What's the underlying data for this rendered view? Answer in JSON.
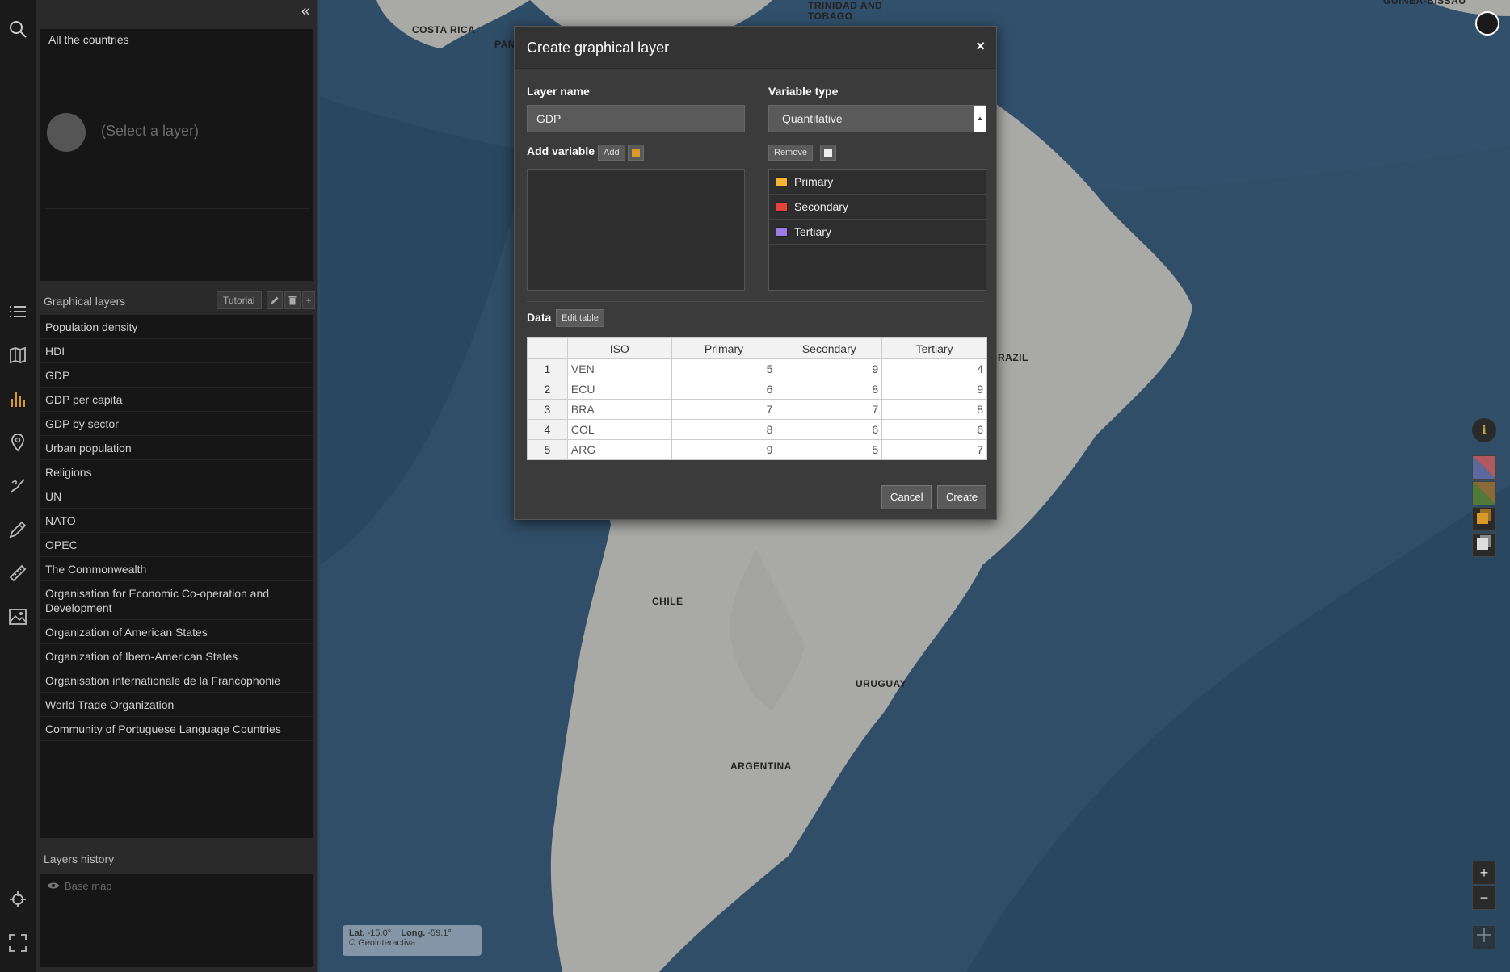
{
  "sidebar": {
    "collapse_icon": "«",
    "tools": [
      {
        "name": "search-icon"
      },
      {
        "name": "list-icon"
      },
      {
        "name": "map-book-icon"
      },
      {
        "name": "bar-chart-icon"
      },
      {
        "name": "location-pin-icon"
      },
      {
        "name": "draw-icon"
      },
      {
        "name": "pencil-icon"
      },
      {
        "name": "ruler-icon"
      },
      {
        "name": "image-icon"
      },
      {
        "name": "crosshair-icon"
      },
      {
        "name": "fullscreen-icon"
      }
    ]
  },
  "countries": {
    "title": "All the countries",
    "placeholder": "(Select a layer)"
  },
  "graphical_layers": {
    "title": "Graphical layers",
    "tutorial_label": "Tutorial",
    "items": [
      "Population density",
      "HDI",
      "GDP",
      "GDP per capita",
      "GDP by sector",
      "Urban population",
      "Religions",
      "UN",
      "NATO",
      "OPEC",
      "The Commonwealth",
      "Organisation for Economic Co-operation and Development",
      "Organization of American States",
      "Organization of Ibero-American States",
      "Organisation internationale de la Francophonie",
      "World Trade Organization",
      "Community of Portuguese Language Countries"
    ]
  },
  "history": {
    "title": "Layers history",
    "item": "Base map"
  },
  "map": {
    "labels": {
      "costa_rica": "COSTA RICA",
      "pana": "PANA",
      "trinidad1": "TRINIDAD AND",
      "trinidad2": "TOBAGO",
      "guinea": "GUINEA-BISSAU",
      "brazil": "RAZIL",
      "chile": "CHILE",
      "uruguay": "URUGUAY",
      "argentina": "ARGENTINA"
    },
    "coords": {
      "lat_label": "Lat.",
      "lat_value": "-15.0°",
      "long_label": "Long.",
      "long_value": "-59.1°",
      "copyright": "© Geointeractiva"
    },
    "zoom_in": "+",
    "zoom_out": "−",
    "info": "i"
  },
  "modal": {
    "title": "Create graphical layer",
    "close": "×",
    "layer_name_label": "Layer name",
    "layer_name_value": "GDP",
    "variable_type_label": "Variable type",
    "variable_type_value": "Quantitative",
    "add_variable_label": "Add variable",
    "add_button": "Add",
    "remove_button": "Remove",
    "variables": [
      {
        "name": "Primary",
        "color": "#f5b731"
      },
      {
        "name": "Secondary",
        "color": "#e8433a"
      },
      {
        "name": "Tertiary",
        "color": "#9a7ee6"
      }
    ],
    "data_label": "Data",
    "edit_table_button": "Edit table",
    "table": {
      "headers": [
        "",
        "ISO",
        "Primary",
        "Secondary",
        "Tertiary"
      ],
      "rows": [
        {
          "n": "1",
          "iso": "VEN",
          "primary": "5",
          "secondary": "9",
          "tertiary": "4"
        },
        {
          "n": "2",
          "iso": "ECU",
          "primary": "6",
          "secondary": "8",
          "tertiary": "9"
        },
        {
          "n": "3",
          "iso": "BRA",
          "primary": "7",
          "secondary": "7",
          "tertiary": "8"
        },
        {
          "n": "4",
          "iso": "COL",
          "primary": "8",
          "secondary": "6",
          "tertiary": "6"
        },
        {
          "n": "5",
          "iso": "ARG",
          "primary": "9",
          "secondary": "5",
          "tertiary": "7"
        }
      ]
    },
    "cancel_button": "Cancel",
    "create_button": "Create"
  }
}
